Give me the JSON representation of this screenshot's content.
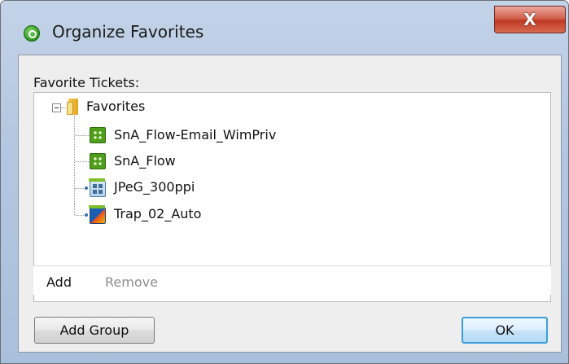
{
  "window": {
    "title": "Organize Favorites",
    "close_label": "X"
  },
  "favorites": {
    "section_label": "Favorite Tickets:",
    "root": {
      "label": "Favorites",
      "icon": "folder-icon",
      "expanded": true,
      "children": [
        {
          "label": "SnA_Flow-Email_WimPriv",
          "icon": "flow-ticket-icon"
        },
        {
          "label": "SnA_Flow",
          "icon": "flow-ticket-icon"
        },
        {
          "label": "JPeG_300ppi",
          "icon": "jpeg-ticket-icon"
        },
        {
          "label": "Trap_02_Auto",
          "icon": "trap-ticket-icon"
        }
      ]
    },
    "actions": {
      "add": "Add",
      "remove": "Remove"
    }
  },
  "buttons": {
    "add_group": "Add Group",
    "ok": "OK"
  },
  "colors": {
    "title_bar": "#b4c7e0",
    "close_button": "#c84a33",
    "ok_border": "#3c9edb",
    "disabled_text": "#8d8d8d"
  }
}
